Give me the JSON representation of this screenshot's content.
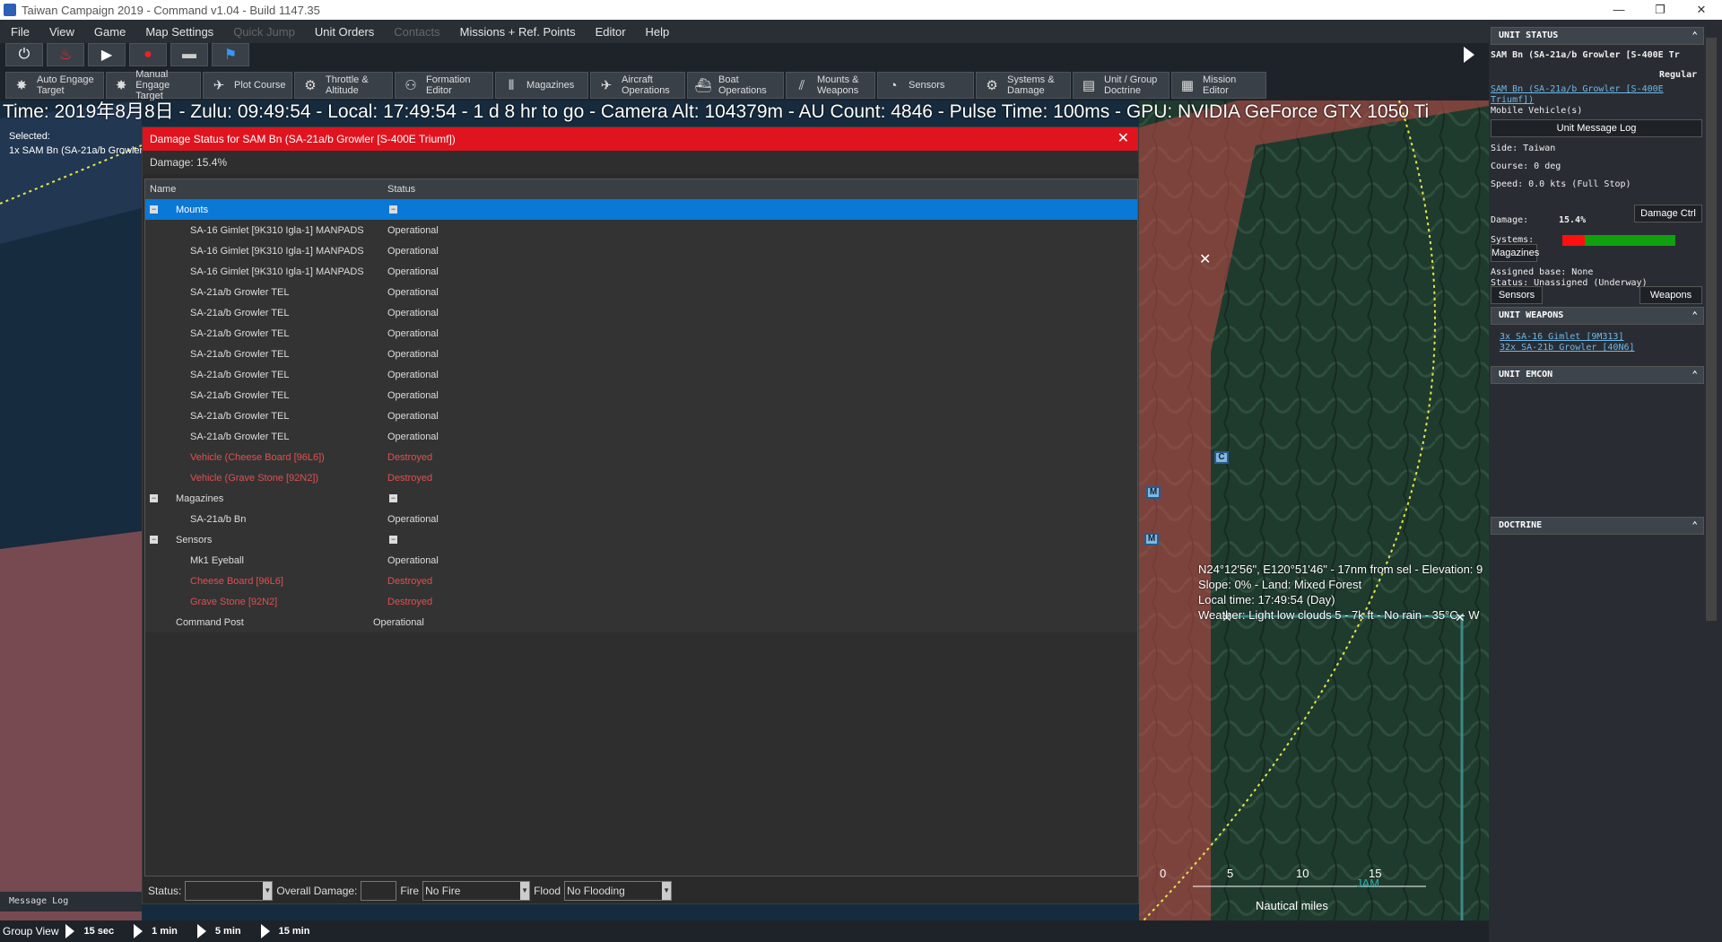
{
  "window": {
    "title": "Taiwan  Campaign 2019 - Command v1.04 - Build 1147.35"
  },
  "menu": {
    "items": [
      "File",
      "View",
      "Game",
      "Map Settings",
      "Quick Jump",
      "Unit Orders",
      "Contacts",
      "Missions + Ref. Points",
      "Editor",
      "Help"
    ],
    "disabled": [
      "Quick Jump",
      "Contacts"
    ]
  },
  "toolbar": {
    "icons": [
      "power-icon",
      "fire-icon",
      "play-icon",
      "record-icon",
      "road-icon",
      "flag-icon"
    ],
    "buttons": [
      {
        "label": "Auto Engage\nTarget",
        "icon": "auto-engage-icon",
        "glyph": "✸"
      },
      {
        "label": "Manual\nEngage Target",
        "icon": "manual-engage-icon",
        "glyph": "✸"
      },
      {
        "label": "Plot Course",
        "icon": "plot-course-icon",
        "glyph": "✈"
      },
      {
        "label": "Throttle &\nAltitude",
        "icon": "throttle-icon",
        "glyph": "⚙"
      },
      {
        "label": "Formation\nEditor",
        "icon": "formation-icon",
        "glyph": "⚇"
      },
      {
        "label": "Magazines",
        "icon": "magazines-icon",
        "glyph": "⦀"
      },
      {
        "label": "Aircraft\nOperations",
        "icon": "aircraft-icon",
        "glyph": "✈"
      },
      {
        "label": "Boat\nOperations",
        "icon": "boat-icon",
        "glyph": "⛴"
      },
      {
        "label": "Mounts &\nWeapons",
        "icon": "mounts-icon",
        "glyph": "⫽"
      },
      {
        "label": "Sensors",
        "icon": "sensors-icon",
        "glyph": "◔"
      },
      {
        "label": "Systems &\nDamage",
        "icon": "systems-icon",
        "glyph": "⚙"
      },
      {
        "label": "Unit / Group\nDoctrine",
        "icon": "doctrine-icon",
        "glyph": "▤"
      },
      {
        "label": "Mission\nEditor",
        "icon": "mission-editor-icon",
        "glyph": "▦"
      }
    ]
  },
  "infobar": "Time: 2019年8月8日 - Zulu: 09:49:54 - Local: 17:49:54 - 1 d 8 hr to go -  Camera Alt: 104379m  - AU Count: 4846 - Pulse Time: 100ms - GPU: NVIDIA GeForce GTX 1050 Ti",
  "selected": {
    "label": "Selected:",
    "unit": "1x SAM Bn (SA-21a/b Growler [S-400E Triumf])"
  },
  "map": {
    "coord_lines": [
      "N24°12'56\", E120°51'46\" - 17nm from sel - Elevation: 9",
      "Slope: 0% - Land: Mixed Forest",
      "Local time: 17:49:54 (Day)",
      "Weather: Light low clouds 5 - 7k ft - No rain - 35°C - W"
    ],
    "scale_numbers": [
      "0",
      "5",
      "10",
      "15"
    ],
    "scale_unit": "Nautical miles",
    "jam_label": "JAM",
    "unit_markers": [
      "M",
      "M",
      "C"
    ]
  },
  "dialog": {
    "title": "Damage Status for SAM Bn (SA-21a/b Growler [S-400E Triumf])",
    "damage": "Damage: 15.4%",
    "col_name": "Name",
    "col_status": "Status",
    "rows": [
      {
        "name": "Mounts",
        "status": "",
        "level": 0,
        "group": true,
        "selected": true
      },
      {
        "name": "SA-16 Gimlet [9K310 Igla-1] MANPADS",
        "status": "Operational",
        "level": 1
      },
      {
        "name": "SA-16 Gimlet [9K310 Igla-1] MANPADS",
        "status": "Operational",
        "level": 1
      },
      {
        "name": "SA-16 Gimlet [9K310 Igla-1] MANPADS",
        "status": "Operational",
        "level": 1
      },
      {
        "name": "SA-21a/b Growler TEL",
        "status": "Operational",
        "level": 1
      },
      {
        "name": "SA-21a/b Growler TEL",
        "status": "Operational",
        "level": 1
      },
      {
        "name": "SA-21a/b Growler TEL",
        "status": "Operational",
        "level": 1
      },
      {
        "name": "SA-21a/b Growler TEL",
        "status": "Operational",
        "level": 1
      },
      {
        "name": "SA-21a/b Growler TEL",
        "status": "Operational",
        "level": 1
      },
      {
        "name": "SA-21a/b Growler TEL",
        "status": "Operational",
        "level": 1
      },
      {
        "name": "SA-21a/b Growler TEL",
        "status": "Operational",
        "level": 1
      },
      {
        "name": "SA-21a/b Growler TEL",
        "status": "Operational",
        "level": 1
      },
      {
        "name": "Vehicle (Cheese Board [96L6])",
        "status": "Destroyed",
        "level": 1,
        "destroyed": true
      },
      {
        "name": "Vehicle (Grave Stone [92N2])",
        "status": "Destroyed",
        "level": 1,
        "destroyed": true
      },
      {
        "name": "Magazines",
        "status": "",
        "level": 0,
        "group": true
      },
      {
        "name": "SA-21a/b Bn",
        "status": "Operational",
        "level": 1
      },
      {
        "name": "Sensors",
        "status": "",
        "level": 0,
        "group": true
      },
      {
        "name": "Mk1 Eyeball",
        "status": "Operational",
        "level": 1
      },
      {
        "name": "Cheese Board [96L6]",
        "status": "Destroyed",
        "level": 1,
        "destroyed": true
      },
      {
        "name": "Grave Stone [92N2]",
        "status": "Destroyed",
        "level": 1,
        "destroyed": true
      },
      {
        "name": "Command Post",
        "status": "Operational",
        "level": 0,
        "plain": true
      }
    ],
    "footer": {
      "status_label": "Status:",
      "status_value": "",
      "overall_label": "Overall Damage:",
      "overall_value": "",
      "fire_label": "Fire",
      "fire_value": "No Fire",
      "flood_label": "Flood",
      "flood_value": "No Flooding"
    }
  },
  "sidebar": {
    "unit_status_header": "UNIT STATUS",
    "unit_name": "SAM Bn (SA-21a/b Growler [S-400E Tr",
    "proficiency": "Regular",
    "class_link_1": "SAM Bn (SA-21a/b Growler [S-400E",
    "class_link_2": "Triumf])",
    "type": "Mobile Vehicle(s)",
    "unit_message_log": "Unit Message Log",
    "side": "Side: Taiwan",
    "course": "Course: 0 deg",
    "speed": "Speed: 0.0 kts (Full Stop)",
    "damage_label": "Damage:",
    "damage_value": "15.4%",
    "damage_ctrl": "Damage Ctrl",
    "systems_label": "Systems:",
    "magazines_btn": "Magazines",
    "assigned_base": "Assigned base: None",
    "status_line": "Status: Unassigned (Underway)",
    "sensors_btn": "Sensors",
    "weapons_btn": "Weapons",
    "unit_weapons_header": "UNIT WEAPONS",
    "weapon_1": "3x SA-16 Gimlet [9M313]",
    "weapon_2": "32x SA-21b Growler [40N6]",
    "unit_emcon_header": "UNIT EMCON",
    "doctrine_header": "DOCTRINE",
    "systems_bar": {
      "damaged_fraction": 0.2,
      "damaged_color": "#ff1010",
      "ok_color": "#10a010"
    }
  },
  "bottom": {
    "message_log": "Message Log",
    "group_view": "Group View",
    "speeds": [
      "15 sec",
      "1 min",
      "5 min",
      "15 min"
    ]
  },
  "colors": {
    "dialog_title": "#e0141e",
    "selected_row": "#0a78d7",
    "destroyed_text": "#e05050"
  }
}
